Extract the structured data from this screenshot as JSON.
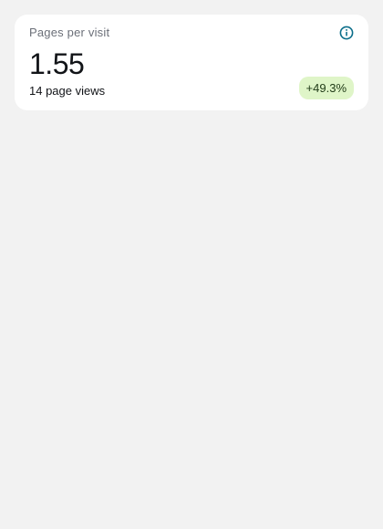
{
  "card": {
    "title": "Pages per visit",
    "value": "1.55",
    "subtext": "14 page views",
    "change": "+49.3%",
    "info_icon": "info-circle-icon"
  },
  "colors": {
    "page_background": "#f2f2f2",
    "card_background": "#ffffff",
    "icon_accent": "#0b6e8a",
    "badge_background": "#dff5c8",
    "badge_text": "#1f3a16"
  }
}
